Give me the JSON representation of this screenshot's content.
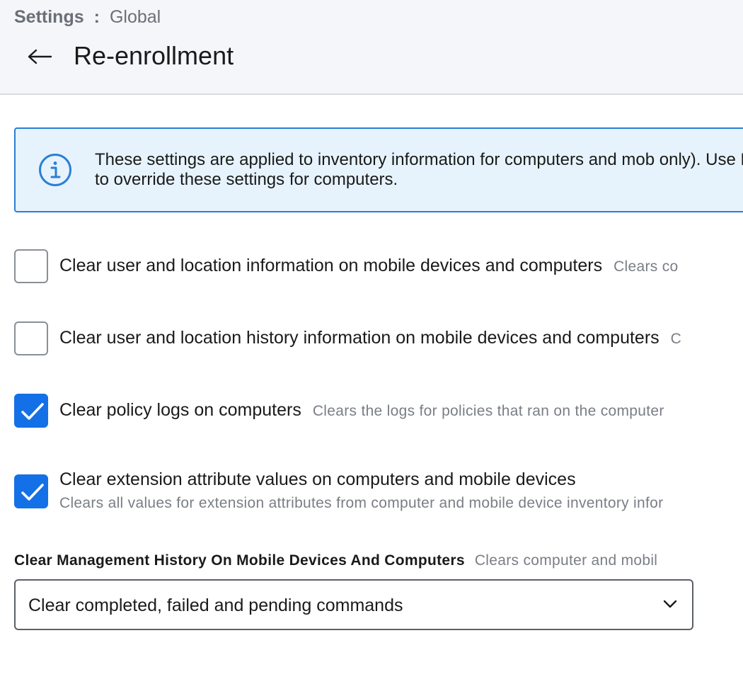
{
  "breadcrumb": {
    "root": "Settings",
    "separator": ":",
    "current": "Global"
  },
  "header": {
    "title": "Re-enrollment",
    "back_icon": "arrow-left-icon"
  },
  "info_banner": {
    "icon": "info-icon",
    "text": "These settings are applied to inventory information for computers and mob only). Use Recon to override these settings for computers."
  },
  "options": [
    {
      "label": "Clear user and location information on mobile devices and computers",
      "description": "Clears co",
      "checked": false
    },
    {
      "label": "Clear user and location history information on mobile devices and computers",
      "description": "C",
      "checked": false
    },
    {
      "label": "Clear policy logs on computers",
      "description": "Clears the logs for policies that ran on the computer",
      "checked": true
    },
    {
      "label": "Clear extension attribute values on computers and mobile devices",
      "description": "Clears all values for extension attributes from computer and mobile device inventory infor",
      "checked": true
    }
  ],
  "management_history": {
    "label": "Clear Management History On Mobile Devices And Computers",
    "description": "Clears computer and mobil",
    "selected": "Clear completed, failed and pending commands"
  },
  "colors": {
    "accent": "#1470e6",
    "info_bg": "#e6f3fd",
    "info_border": "#2a7fd6",
    "header_bg": "#f4f6f9"
  }
}
